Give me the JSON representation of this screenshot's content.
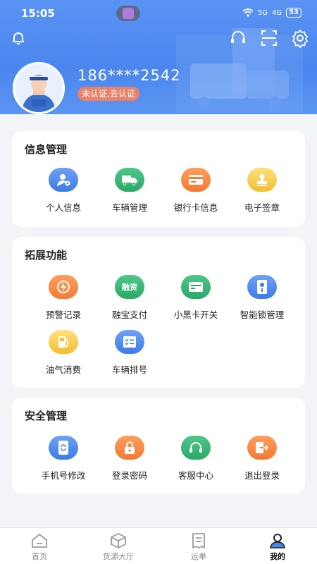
{
  "status_bar": {
    "time": "15:05",
    "signal1": "5G",
    "signal2": "4G",
    "battery": "53"
  },
  "profile": {
    "phone": "186****2542",
    "auth_status": "未认证,去认证"
  },
  "sections": [
    {
      "title": "信息管理",
      "items": [
        {
          "label": "个人信息",
          "icon": "person-gear-icon",
          "color": "#4f8af0"
        },
        {
          "label": "车辆管理",
          "icon": "truck-icon",
          "color": "#3dbb7a"
        },
        {
          "label": "银行卡信息",
          "icon": "bank-card-icon",
          "color": "#f78a46"
        },
        {
          "label": "电子签章",
          "icon": "stamp-icon",
          "color": "#f6cb4a"
        }
      ]
    },
    {
      "title": "拓展功能",
      "items": [
        {
          "label": "预警记录",
          "icon": "alert-bolt-icon",
          "color": "#f78a46"
        },
        {
          "label": "融宝支付",
          "icon": "pay-icon",
          "color": "#3dbb7a",
          "text": "融资"
        },
        {
          "label": "小黑卡开关",
          "icon": "card-toggle-icon",
          "color": "#3dbb7a"
        },
        {
          "label": "智能锁管理",
          "icon": "smart-lock-icon",
          "color": "#4f8af0"
        },
        {
          "label": "油气消费",
          "icon": "fuel-icon",
          "color": "#f6cb4a"
        },
        {
          "label": "车辆排号",
          "icon": "queue-list-icon",
          "color": "#4f8af0"
        }
      ]
    },
    {
      "title": "安全管理",
      "items": [
        {
          "label": "手机号修改",
          "icon": "phone-edit-icon",
          "color": "#4f8af0"
        },
        {
          "label": "登录密码",
          "icon": "lock-icon",
          "color": "#f78a46"
        },
        {
          "label": "客服中心",
          "icon": "headset-icon",
          "color": "#3dbb7a"
        },
        {
          "label": "退出登录",
          "icon": "logout-icon",
          "color": "#f78a46"
        }
      ]
    }
  ],
  "tabs": [
    {
      "label": "首页",
      "icon": "home-icon"
    },
    {
      "label": "货源大厅",
      "icon": "box-icon"
    },
    {
      "label": "运单",
      "icon": "receipt-icon"
    },
    {
      "label": "我的",
      "icon": "user-icon",
      "active": true
    }
  ]
}
